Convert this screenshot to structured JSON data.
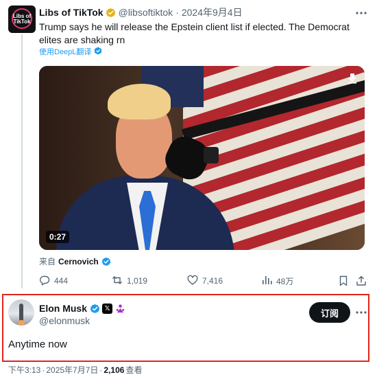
{
  "quoted_post": {
    "display_name": "Libs of TikTok",
    "handle": "@libsoftiktok",
    "separator": "·",
    "date": "2024年9月4日",
    "text": "Trump says he will release the Epstein client list if elected. The Democrat elites are shaking rn",
    "translate_label": "使用DeepL翻译",
    "video_duration": "0:27",
    "from_prefix": "来自",
    "from_source": "Cernovich",
    "avatar_text": "Libs of TikTok",
    "actions": {
      "replies": "444",
      "reposts": "1,019",
      "likes": "7,416",
      "views": "48万"
    }
  },
  "main_post": {
    "display_name": "Elon Musk",
    "handle": "@elonmusk",
    "subscribe_label": "订阅",
    "text": "Anytime now",
    "time": "下午3:13",
    "separator": "·",
    "date": "2025年7月7日",
    "views_count": "2,106",
    "views_label": "查看",
    "x_badge_text": "𝕏"
  },
  "icons": {
    "more": "more-icon",
    "verified_gold": "verified-gold-icon",
    "verified_blue": "verified-blue-icon",
    "download": "download-icon",
    "reply": "reply-icon",
    "repost": "repost-icon",
    "like": "like-icon",
    "views": "views-icon",
    "bookmark": "bookmark-icon",
    "share": "share-icon",
    "affiliate": "affiliate-icon"
  },
  "colors": {
    "accent_blue": "#1d9bf0",
    "gold": "#e8b10c",
    "highlight_red": "#e0241b",
    "text_primary": "#0f1419",
    "text_secondary": "#536471"
  }
}
